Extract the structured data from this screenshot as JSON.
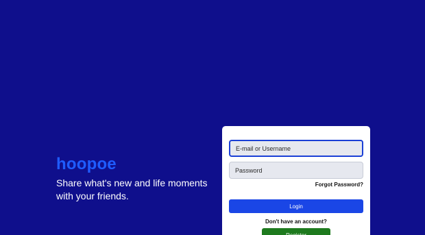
{
  "hero": {
    "brand": "hoopoe",
    "tagline": "Share what's new and life moments with your friends."
  },
  "login_form": {
    "email_placeholder": "E-mail or Username",
    "password_placeholder": "Password",
    "forgot_password": "Forgot Password?",
    "login_label": "Login",
    "no_account_text": "Don't have an account?",
    "register_label": "Register"
  },
  "colors": {
    "background": "#0f0f8c",
    "brand": "#1f5cff",
    "login_button": "#1a46e6",
    "register_button": "#1e7a1e"
  }
}
